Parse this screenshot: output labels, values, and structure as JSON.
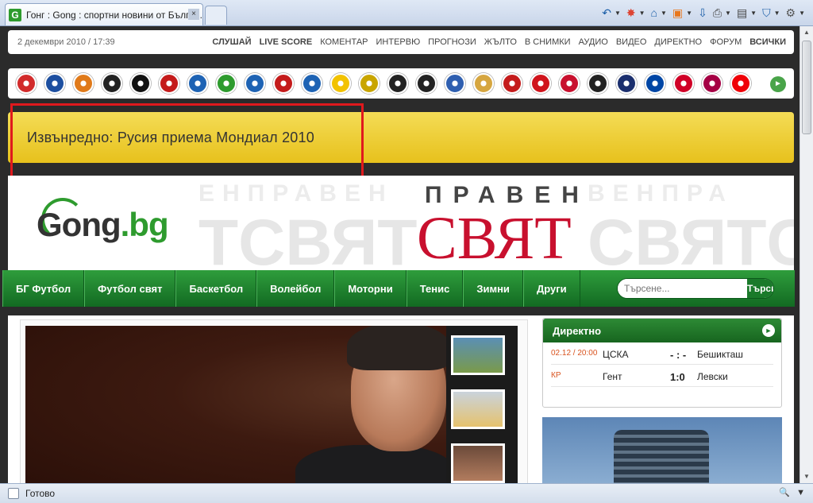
{
  "browser": {
    "tab_title": "Гонг : Gong : спортни новини от Бълга...",
    "favicon_letter": "G",
    "tab_close": "×",
    "toolbar_icons": [
      "back-icon",
      "flash-icon",
      "home-icon",
      "rss-icon",
      "download-icon",
      "print-icon",
      "page-icon",
      "shield-icon",
      "gear-icon"
    ],
    "status_text": "Готово",
    "zoom_glyph": "🔍"
  },
  "topbar": {
    "date": "2 декември 2010 / 17:39",
    "nav": [
      {
        "label": "СЛУШАЙ",
        "bold": true
      },
      {
        "label": "LIVE SCORE",
        "bold": true
      },
      {
        "label": "КОМЕНТАР",
        "bold": false
      },
      {
        "label": "ИНТЕРВЮ",
        "bold": false
      },
      {
        "label": "ПРОГНОЗИ",
        "bold": false
      },
      {
        "label": "ЖЪЛТО",
        "bold": false
      },
      {
        "label": "В СНИМКИ",
        "bold": false
      },
      {
        "label": "АУДИО",
        "bold": false
      },
      {
        "label": "ВИДЕО",
        "bold": false
      },
      {
        "label": "ДИРЕКТНО",
        "bold": false
      },
      {
        "label": "ФОРУМ",
        "bold": false
      },
      {
        "label": "ВСИЧКИ",
        "bold": true
      }
    ]
  },
  "clubs": {
    "crest_colors": [
      "#d22b2b",
      "#1d4fa0",
      "#e07a1a",
      "#222222",
      "#111111",
      "#c41b1b",
      "#1e63b4",
      "#2e9b2e",
      "#1e63b4",
      "#c41b1b",
      "#1e63b4",
      "#f2c200",
      "#c9a500",
      "#222222",
      "#222222",
      "#2f5fb0",
      "#d6a640",
      "#c41b1b",
      "#d0141c",
      "#c8102e",
      "#222222",
      "#1b2f6e",
      "#0046a5",
      "#d00027",
      "#a50044",
      "#ef0107"
    ],
    "next": "►"
  },
  "breaking": "Извънредно: Русия приема Мондиал 2010",
  "banner": {
    "logo_prefix": "G",
    "logo_rest": "ong",
    "logo_dot": ".bg",
    "praven": "ПРАВЕН",
    "svyat": "СВЯТ",
    "ghost_top": "ЕНПРАВЕН",
    "ghost_bottom": "ТСВЯТ",
    "ghost_top2": "ВЕНПРА",
    "ghost_bottom2": "СВЯТСЕ"
  },
  "menu": {
    "items": [
      "БГ Футбол",
      "Футбол свят",
      "Баскетбол",
      "Волейбол",
      "Моторни",
      "Тенис",
      "Зимни",
      "Други"
    ],
    "search_placeholder": "Търсене...",
    "search_button": "Търси"
  },
  "live": {
    "title": "Директно",
    "rows": [
      {
        "time": "02.12 / 20:00",
        "home": "ЦСКА",
        "score": "- : -",
        "away": "Бешикташ"
      },
      {
        "time": "КР",
        "home": "Гент",
        "score": "1:0",
        "away": "Левски"
      }
    ]
  }
}
